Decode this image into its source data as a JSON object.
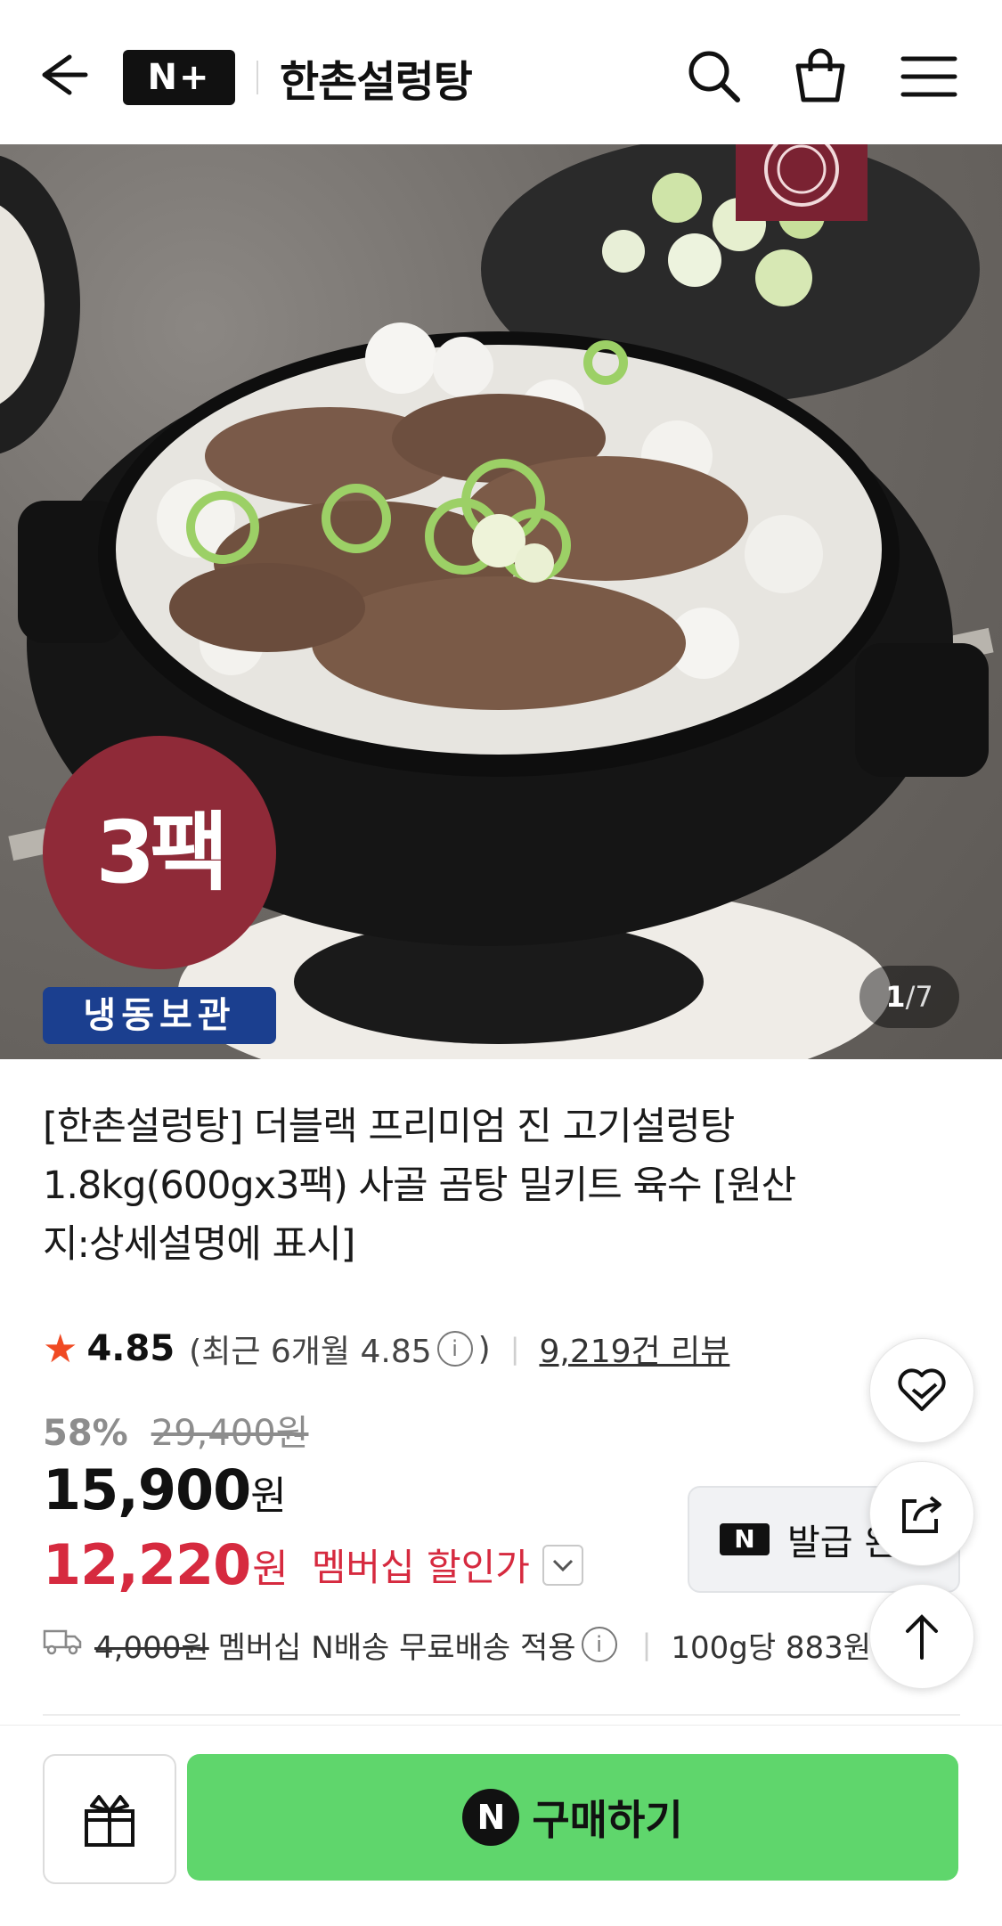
{
  "header": {
    "logo_text": "N+",
    "store_title": "한촌설렁탕",
    "icons": [
      "back-arrow-icon",
      "search-icon",
      "shopping-bag-icon",
      "hamburger-menu-icon"
    ]
  },
  "hero": {
    "badge_pack": "3팩",
    "badge_storage": "냉동보관",
    "image_index": "1",
    "image_total": "/7"
  },
  "product": {
    "title": "[한촌설렁탕] 더블랙 프리미엄 진 고기설렁탕 1.8kg(600gx3팩) 사골 곰탕 밀키트 육수 [원산지:상세설명에 표시]",
    "rating": "4.85",
    "rating_recent_prefix": "(최근 6개월 4.85",
    "rating_recent_suffix": ")",
    "info_glyph": "i",
    "review_count": "9,219건 리뷰",
    "discount_rate": "58%",
    "original_price": "29,400원",
    "sale_price": "15,900",
    "sale_unit": "원",
    "member_price": "12,220",
    "member_unit": "원",
    "member_label": "멤버십 할인가",
    "coupon_badge": "N",
    "coupon_label": "발급 완",
    "shipping_fee_struck": "4,000원",
    "shipping_note": "멤버십 N배송 무료배송 적용",
    "unit_price": "100g당 883원"
  },
  "bottom_bar": {
    "buy_badge": "N",
    "buy_label": "구매하기"
  },
  "colors": {
    "accent_red": "#d62a3f",
    "star_orange": "#f04a23",
    "buy_green": "#5fd66c",
    "pack_badge": "#8f2a38",
    "frozen_badge": "#1b3f8f"
  }
}
